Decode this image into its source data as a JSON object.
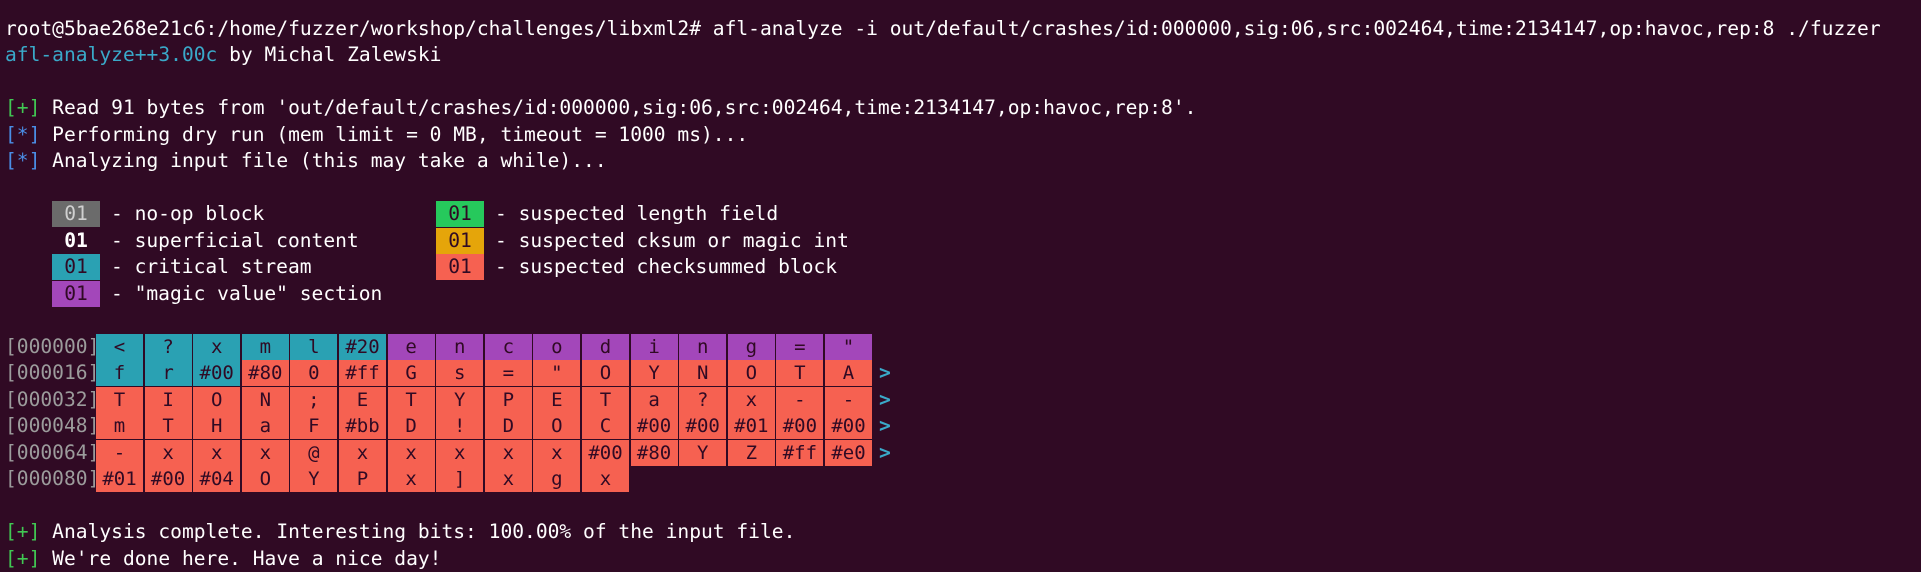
{
  "terminal": {
    "prompt_line": "root@5bae268e21c6:/home/fuzzer/workshop/challenges/libxml2# afl-analyze -i out/default/crashes/id:000000,sig:06,src:002464,time:2134147,op:havoc,rep:8 ./fuzzer",
    "banner_name": "afl-analyze++3.00c",
    "banner_by": " by Michal Zalewski",
    "msg_read_tag": "[+]",
    "msg_read": " Read 91 bytes from 'out/default/crashes/id:000000,sig:06,src:002464,time:2134147,op:havoc,rep:8'.",
    "msg_dry_tag": "[*]",
    "msg_dry": " Performing dry run (mem limit = 0 MB, timeout = 1000 ms)...",
    "msg_analyze_tag": "[*]",
    "msg_analyze": " Analyzing input file (this may take a while)...",
    "msg_complete_tag": "[+]",
    "msg_complete": " Analysis complete. Interesting bits: 100.00% of the input file.",
    "msg_done_tag": "[+]",
    "msg_done": " We're done here. Have a nice day!"
  },
  "legend": [
    {
      "chip": "01",
      "label": "- no-op block",
      "color": "#6b6b6b",
      "text_color": "#d0d0d0",
      "bold": false
    },
    {
      "chip": "01",
      "label": "- superficial content",
      "color": "#300a24",
      "text_color": "#ffffff",
      "bold": true
    },
    {
      "chip": "01",
      "label": "- critical stream",
      "color": "#2aa1b3",
      "text_color": "#300a24",
      "bold": false
    },
    {
      "chip": "01",
      "label": "- \"magic value\" section",
      "color": "#a347ba",
      "text_color": "#300a24",
      "bold": false
    },
    {
      "chip": "01",
      "label": "- suspected length field",
      "color": "#26c95c",
      "text_color": "#300a24",
      "bold": false
    },
    {
      "chip": "01",
      "label": "- suspected cksum or magic int",
      "color": "#e5a50a",
      "text_color": "#300a24",
      "bold": false
    },
    {
      "chip": "01",
      "label": "- suspected checksummed block",
      "color": "#f66151",
      "text_color": "#300a24",
      "bold": false
    }
  ],
  "colors": {
    "background": "#300a24",
    "critical": "#2aa1b3",
    "magic": "#a347ba",
    "checksummed": "#f66151",
    "prompt_cyan": "#3aa9c9",
    "tag_green": "#41c853",
    "tag_blue": "#4a8ee6"
  },
  "hexdump": [
    {
      "offset": "[000000]",
      "arrow": false,
      "cells": [
        {
          "t": "<",
          "k": "critical"
        },
        {
          "t": "?",
          "k": "critical"
        },
        {
          "t": "x",
          "k": "critical"
        },
        {
          "t": "m",
          "k": "critical"
        },
        {
          "t": "l",
          "k": "critical"
        },
        {
          "t": "#20",
          "k": "critical"
        },
        {
          "t": "e",
          "k": "magic"
        },
        {
          "t": "n",
          "k": "magic"
        },
        {
          "t": "c",
          "k": "magic"
        },
        {
          "t": "o",
          "k": "magic"
        },
        {
          "t": "d",
          "k": "magic"
        },
        {
          "t": "i",
          "k": "magic"
        },
        {
          "t": "n",
          "k": "magic"
        },
        {
          "t": "g",
          "k": "magic"
        },
        {
          "t": "=",
          "k": "magic"
        },
        {
          "t": "\"",
          "k": "magic"
        }
      ]
    },
    {
      "offset": "[000016]",
      "arrow": true,
      "cells": [
        {
          "t": "f",
          "k": "critical"
        },
        {
          "t": "r",
          "k": "critical"
        },
        {
          "t": "#00",
          "k": "critical"
        },
        {
          "t": "#80",
          "k": "checksummed"
        },
        {
          "t": "0",
          "k": "checksummed"
        },
        {
          "t": "#ff",
          "k": "checksummed"
        },
        {
          "t": "G",
          "k": "checksummed"
        },
        {
          "t": "s",
          "k": "checksummed"
        },
        {
          "t": "=",
          "k": "checksummed"
        },
        {
          "t": "\"",
          "k": "checksummed"
        },
        {
          "t": "O",
          "k": "checksummed"
        },
        {
          "t": "Y",
          "k": "checksummed"
        },
        {
          "t": "N",
          "k": "checksummed"
        },
        {
          "t": "O",
          "k": "checksummed"
        },
        {
          "t": "T",
          "k": "checksummed"
        },
        {
          "t": "A",
          "k": "checksummed"
        }
      ]
    },
    {
      "offset": "[000032]",
      "arrow": true,
      "cells": [
        {
          "t": "T",
          "k": "checksummed"
        },
        {
          "t": "I",
          "k": "checksummed"
        },
        {
          "t": "O",
          "k": "checksummed"
        },
        {
          "t": "N",
          "k": "checksummed"
        },
        {
          "t": ";",
          "k": "checksummed"
        },
        {
          "t": "E",
          "k": "checksummed"
        },
        {
          "t": "T",
          "k": "checksummed"
        },
        {
          "t": "Y",
          "k": "checksummed"
        },
        {
          "t": "P",
          "k": "checksummed"
        },
        {
          "t": "E",
          "k": "checksummed"
        },
        {
          "t": "T",
          "k": "checksummed"
        },
        {
          "t": "a",
          "k": "checksummed"
        },
        {
          "t": "?",
          "k": "checksummed"
        },
        {
          "t": "x",
          "k": "checksummed"
        },
        {
          "t": "-",
          "k": "checksummed"
        },
        {
          "t": "-",
          "k": "checksummed"
        }
      ]
    },
    {
      "offset": "[000048]",
      "arrow": true,
      "cells": [
        {
          "t": "m",
          "k": "checksummed"
        },
        {
          "t": "T",
          "k": "checksummed"
        },
        {
          "t": "H",
          "k": "checksummed"
        },
        {
          "t": "a",
          "k": "checksummed"
        },
        {
          "t": "F",
          "k": "checksummed"
        },
        {
          "t": "#bb",
          "k": "checksummed"
        },
        {
          "t": "D",
          "k": "checksummed"
        },
        {
          "t": "!",
          "k": "checksummed"
        },
        {
          "t": "D",
          "k": "checksummed"
        },
        {
          "t": "O",
          "k": "checksummed"
        },
        {
          "t": "C",
          "k": "checksummed"
        },
        {
          "t": "#00",
          "k": "checksummed"
        },
        {
          "t": "#00",
          "k": "checksummed"
        },
        {
          "t": "#01",
          "k": "checksummed"
        },
        {
          "t": "#00",
          "k": "checksummed"
        },
        {
          "t": "#00",
          "k": "checksummed"
        }
      ]
    },
    {
      "offset": "[000064]",
      "arrow": true,
      "cells": [
        {
          "t": "-",
          "k": "checksummed"
        },
        {
          "t": "x",
          "k": "checksummed"
        },
        {
          "t": "x",
          "k": "checksummed"
        },
        {
          "t": "x",
          "k": "checksummed"
        },
        {
          "t": "@",
          "k": "checksummed"
        },
        {
          "t": "x",
          "k": "checksummed"
        },
        {
          "t": "x",
          "k": "checksummed"
        },
        {
          "t": "x",
          "k": "checksummed"
        },
        {
          "t": "x",
          "k": "checksummed"
        },
        {
          "t": "x",
          "k": "checksummed"
        },
        {
          "t": "#00",
          "k": "checksummed"
        },
        {
          "t": "#80",
          "k": "checksummed"
        },
        {
          "t": "Y",
          "k": "checksummed"
        },
        {
          "t": "Z",
          "k": "checksummed"
        },
        {
          "t": "#ff",
          "k": "checksummed"
        },
        {
          "t": "#e0",
          "k": "checksummed"
        }
      ]
    },
    {
      "offset": "[000080]",
      "arrow": false,
      "cells": [
        {
          "t": "#01",
          "k": "checksummed"
        },
        {
          "t": "#00",
          "k": "checksummed"
        },
        {
          "t": "#04",
          "k": "checksummed"
        },
        {
          "t": "O",
          "k": "checksummed"
        },
        {
          "t": "Y",
          "k": "checksummed"
        },
        {
          "t": "P",
          "k": "checksummed"
        },
        {
          "t": "x",
          "k": "checksummed"
        },
        {
          "t": "]",
          "k": "checksummed"
        },
        {
          "t": "x",
          "k": "checksummed"
        },
        {
          "t": "g",
          "k": "checksummed"
        },
        {
          "t": "x",
          "k": "checksummed"
        }
      ]
    }
  ],
  "arrow_glyph": ">"
}
